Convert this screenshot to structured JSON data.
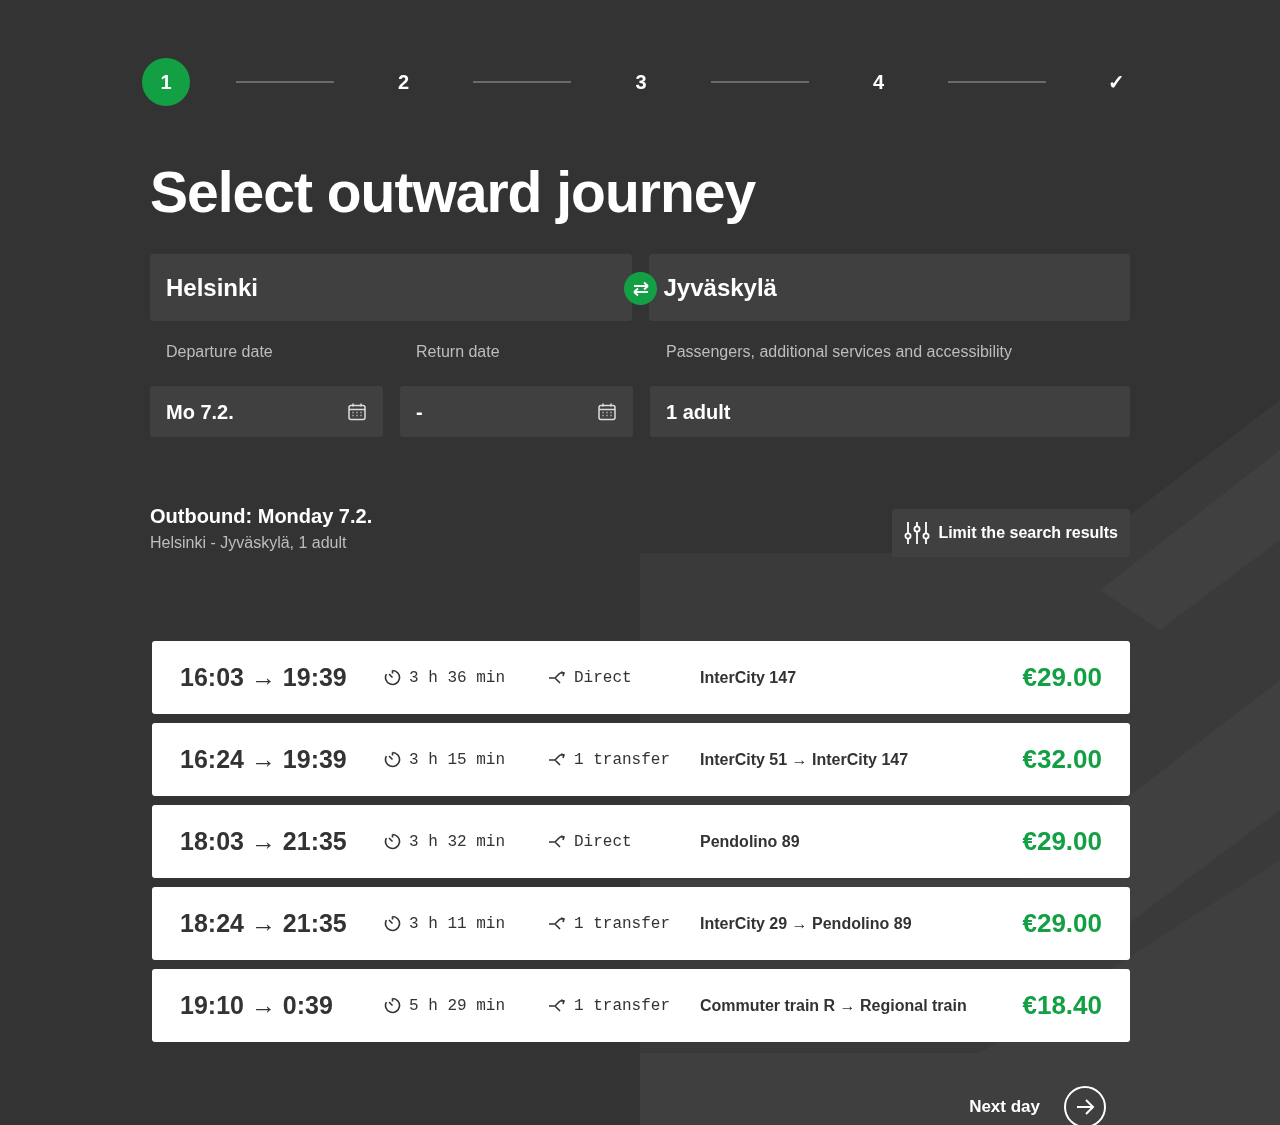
{
  "steps": [
    {
      "label": "1",
      "selected": true
    },
    {
      "label": "2",
      "selected": false
    },
    {
      "label": "3",
      "selected": false
    },
    {
      "label": "4",
      "selected": false
    },
    {
      "label": "✓",
      "selected": false
    }
  ],
  "title": "Select outward journey",
  "from": {
    "value": "Helsinki"
  },
  "to": {
    "value": "Jyväskylä"
  },
  "departure": {
    "label": "Departure date",
    "value": "Mo 7.2."
  },
  "return": {
    "label": "Return date",
    "value": "-"
  },
  "passengers": {
    "label": "Passengers, additional services and accessibility",
    "value": "1 adult"
  },
  "outbound": {
    "heading": "Outbound: Monday 7.2.",
    "summary": "Helsinki - Jyväskylä, 1 adult"
  },
  "filter_button": "Limit the search results",
  "journeys": [
    {
      "times": "16:03 → 19:39",
      "duration": "3 h 36 min",
      "transfers": "Direct",
      "trains": "InterCity 147",
      "price": "€29.00"
    },
    {
      "times": "16:24 → 19:39",
      "duration": "3 h 15 min",
      "transfers": "1 transfer",
      "trains": "InterCity 51 → InterCity 147",
      "price": "€32.00"
    },
    {
      "times": "18:03 → 21:35",
      "duration": "3 h 32 min",
      "transfers": "Direct",
      "trains": "Pendolino 89",
      "price": "€29.00"
    },
    {
      "times": "18:24 → 21:35",
      "duration": "3 h 11 min",
      "transfers": "1 transfer",
      "trains": "InterCity 29 → Pendolino 89",
      "price": "€29.00"
    },
    {
      "times": "19:10 → 0:39",
      "duration": "5 h 29 min",
      "transfers": "1 transfer",
      "trains": "Commuter train R → Regional train",
      "price": "€18.40"
    }
  ],
  "next_day": "Next day"
}
